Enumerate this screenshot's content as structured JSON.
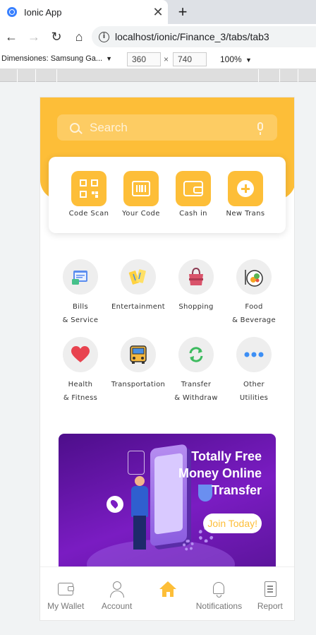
{
  "browser": {
    "tab_title": "Ionic App",
    "tab_close": "✕",
    "new_tab": "+",
    "back": "←",
    "forward": "→",
    "reload": "↻",
    "home": "⌂",
    "url": "localhost/ionic/Finance_3/tabs/tab3"
  },
  "devtools": {
    "device": "Dimensiones: Samsung Ga...",
    "caret": "▼",
    "width": "360",
    "x": "×",
    "height": "740",
    "zoom": "100%",
    "zoom_caret": "▼"
  },
  "search": {
    "placeholder": "Search"
  },
  "quick_actions": [
    {
      "label": "Code Scan",
      "icon": "qr-code-icon"
    },
    {
      "label": "Your Code",
      "icon": "barcode-icon"
    },
    {
      "label": "Cash in",
      "icon": "wallet-icon"
    },
    {
      "label": "New Trans",
      "icon": "plus-circle-icon"
    }
  ],
  "categories": [
    {
      "line1": "Bills",
      "line2": "& Service",
      "icon": "bill-icon"
    },
    {
      "line1": "Entertainment",
      "line2": "",
      "icon": "ticket-icon"
    },
    {
      "line1": "Shopping",
      "line2": "",
      "icon": "shopping-bag-icon"
    },
    {
      "line1": "Food",
      "line2": "& Beverage",
      "icon": "food-icon"
    },
    {
      "line1": "Health",
      "line2": "& Fitness",
      "icon": "heart-icon"
    },
    {
      "line1": "Transportation",
      "line2": "",
      "icon": "bus-icon"
    },
    {
      "line1": "Transfer",
      "line2": "& Withdraw",
      "icon": "transfer-icon"
    },
    {
      "line1": "Other",
      "line2": "Utilities",
      "icon": "more-icon"
    }
  ],
  "banner": {
    "title_line1": "Totally Free",
    "title_line2": "Money Online",
    "title_line3": "Transfer",
    "cta": "Join Today!"
  },
  "tabs": [
    {
      "label": "My Wallet",
      "icon": "wallet-icon",
      "active": false
    },
    {
      "label": "Account",
      "icon": "person-icon",
      "active": false
    },
    {
      "label": "",
      "icon": "home-icon",
      "active": true
    },
    {
      "label": "Notifications",
      "icon": "bell-icon",
      "active": false
    },
    {
      "label": "Report",
      "icon": "document-icon",
      "active": false
    }
  ],
  "colors": {
    "accent": "#fdbe38",
    "banner": "#7a1cc2"
  }
}
